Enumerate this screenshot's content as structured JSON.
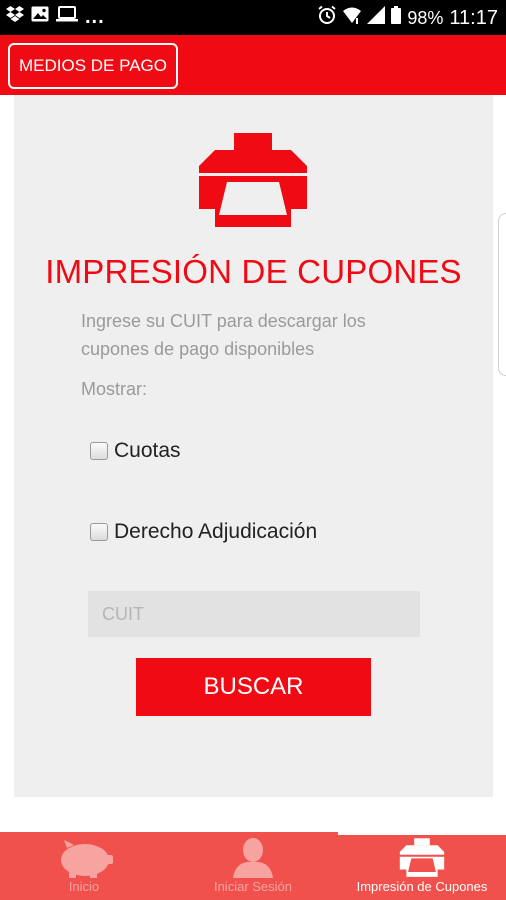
{
  "status_bar": {
    "icons": [
      "dropbox-icon",
      "image-icon",
      "laptop-icon",
      "more-dots",
      "alarm-icon",
      "wifi-icon",
      "signal-icon",
      "battery-icon"
    ],
    "dots": "...",
    "battery": "98%",
    "time": "11:17"
  },
  "header": {
    "medios_label": "MEDIOS DE PAGO"
  },
  "main": {
    "title": "IMPRESIÓN DE CUPONES",
    "description": "Ingrese su CUIT para descargar los cupones de pago disponibles",
    "show_label": "Mostrar:",
    "options": [
      {
        "label": "Cuotas",
        "checked": false
      },
      {
        "label": "Derecho Adjudicación",
        "checked": false
      }
    ],
    "cuit_placeholder": "CUIT",
    "search_label": "BUSCAR"
  },
  "bottom_nav": {
    "items": [
      {
        "label": "Inicio",
        "icon": "piggy-bank-icon",
        "active": false
      },
      {
        "label": "Iniciar Sesión",
        "icon": "user-icon",
        "active": false
      },
      {
        "label": "Impresión de Cupones",
        "icon": "printer-icon",
        "active": true
      }
    ]
  },
  "colors": {
    "accent": "#f00a13",
    "nav_background": "#f0514d",
    "card_background": "#efefef",
    "muted_text": "#9a9a9a"
  }
}
